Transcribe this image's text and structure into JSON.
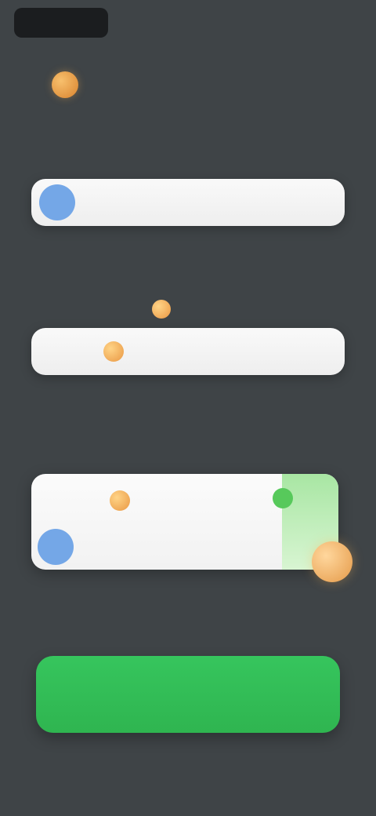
{
  "header": {
    "title": "",
    "extra": ""
  },
  "sections": [
    {
      "label": "",
      "field_text": "",
      "hint": ""
    },
    {
      "label": "",
      "field_text": "",
      "hint": ""
    },
    {
      "label": "",
      "card_row1": "",
      "card_row2": "",
      "link": ""
    }
  ],
  "cta": {
    "label": ""
  },
  "colors": {
    "background": "#3f4447",
    "field": "#f3f3f3",
    "accent_blue": "#74a7e7",
    "accent_orange": "#e99743",
    "accent_green": "#2fb550"
  },
  "icons": {
    "title_icon": "orange-badge-icon",
    "profile_icon": "blue-avatar-icon",
    "token_icon": "orange-token-icon",
    "success_icon": "green-check-icon"
  }
}
